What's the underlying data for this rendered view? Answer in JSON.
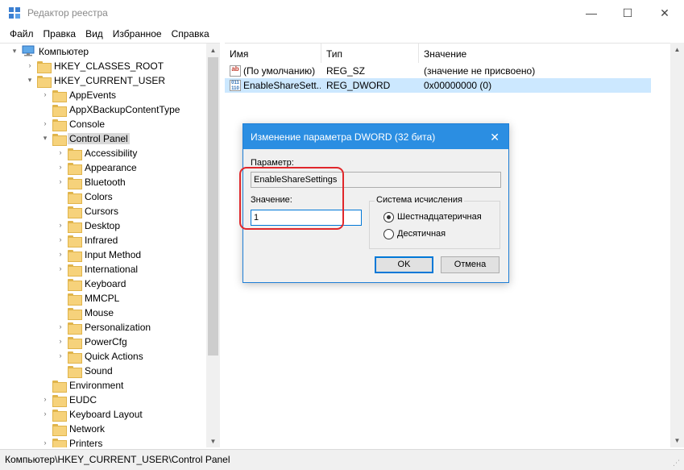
{
  "window": {
    "title": "Редактор реестра",
    "min": "—",
    "max": "☐",
    "close": "✕"
  },
  "menu": [
    "Файл",
    "Правка",
    "Вид",
    "Избранное",
    "Справка"
  ],
  "tree": [
    {
      "label": "Компьютер",
      "indent": 0,
      "arrow": "▾",
      "icon": "computer"
    },
    {
      "label": "HKEY_CLASSES_ROOT",
      "indent": 1,
      "arrow": "›",
      "icon": "folder"
    },
    {
      "label": "HKEY_CURRENT_USER",
      "indent": 1,
      "arrow": "▾",
      "icon": "folder"
    },
    {
      "label": "AppEvents",
      "indent": 2,
      "arrow": "›",
      "icon": "folder"
    },
    {
      "label": "AppXBackupContentType",
      "indent": 2,
      "arrow": "",
      "icon": "folder"
    },
    {
      "label": "Console",
      "indent": 2,
      "arrow": "›",
      "icon": "folder"
    },
    {
      "label": "Control Panel",
      "indent": 2,
      "arrow": "▾",
      "icon": "folder",
      "selected": true
    },
    {
      "label": "Accessibility",
      "indent": 3,
      "arrow": "›",
      "icon": "folder"
    },
    {
      "label": "Appearance",
      "indent": 3,
      "arrow": "›",
      "icon": "folder"
    },
    {
      "label": "Bluetooth",
      "indent": 3,
      "arrow": "›",
      "icon": "folder"
    },
    {
      "label": "Colors",
      "indent": 3,
      "arrow": "",
      "icon": "folder"
    },
    {
      "label": "Cursors",
      "indent": 3,
      "arrow": "",
      "icon": "folder"
    },
    {
      "label": "Desktop",
      "indent": 3,
      "arrow": "›",
      "icon": "folder"
    },
    {
      "label": "Infrared",
      "indent": 3,
      "arrow": "›",
      "icon": "folder"
    },
    {
      "label": "Input Method",
      "indent": 3,
      "arrow": "›",
      "icon": "folder"
    },
    {
      "label": "International",
      "indent": 3,
      "arrow": "›",
      "icon": "folder"
    },
    {
      "label": "Keyboard",
      "indent": 3,
      "arrow": "",
      "icon": "folder"
    },
    {
      "label": "MMCPL",
      "indent": 3,
      "arrow": "",
      "icon": "folder"
    },
    {
      "label": "Mouse",
      "indent": 3,
      "arrow": "",
      "icon": "folder"
    },
    {
      "label": "Personalization",
      "indent": 3,
      "arrow": "›",
      "icon": "folder"
    },
    {
      "label": "PowerCfg",
      "indent": 3,
      "arrow": "›",
      "icon": "folder"
    },
    {
      "label": "Quick Actions",
      "indent": 3,
      "arrow": "›",
      "icon": "folder"
    },
    {
      "label": "Sound",
      "indent": 3,
      "arrow": "",
      "icon": "folder"
    },
    {
      "label": "Environment",
      "indent": 2,
      "arrow": "",
      "icon": "folder"
    },
    {
      "label": "EUDC",
      "indent": 2,
      "arrow": "›",
      "icon": "folder"
    },
    {
      "label": "Keyboard Layout",
      "indent": 2,
      "arrow": "›",
      "icon": "folder"
    },
    {
      "label": "Network",
      "indent": 2,
      "arrow": "",
      "icon": "folder"
    },
    {
      "label": "Printers",
      "indent": 2,
      "arrow": "›",
      "icon": "folder"
    }
  ],
  "list": {
    "columns": [
      "Имя",
      "Тип",
      "Значение"
    ],
    "rows": [
      {
        "name": "(По умолчанию)",
        "type": "REG_SZ",
        "value": "(значение не присвоено)",
        "icon": "ab",
        "selected": false
      },
      {
        "name": "EnableShareSett...",
        "type": "REG_DWORD",
        "value": "0x00000000 (0)",
        "icon": "011",
        "selected": true
      }
    ]
  },
  "status": "Компьютер\\HKEY_CURRENT_USER\\Control Panel",
  "dialog": {
    "title": "Изменение параметра DWORD (32 бита)",
    "param_label": "Параметр:",
    "param_value": "EnableShareSettings",
    "value_label": "Значение:",
    "value": "1",
    "base_legend": "Система исчисления",
    "radio_hex": "Шестнадцатеричная",
    "radio_dec": "Десятичная",
    "ok": "OK",
    "cancel": "Отмена"
  },
  "colors": {
    "accent": "#2b8ee2",
    "selection": "#cce8ff",
    "highlight": "#e0272b"
  }
}
